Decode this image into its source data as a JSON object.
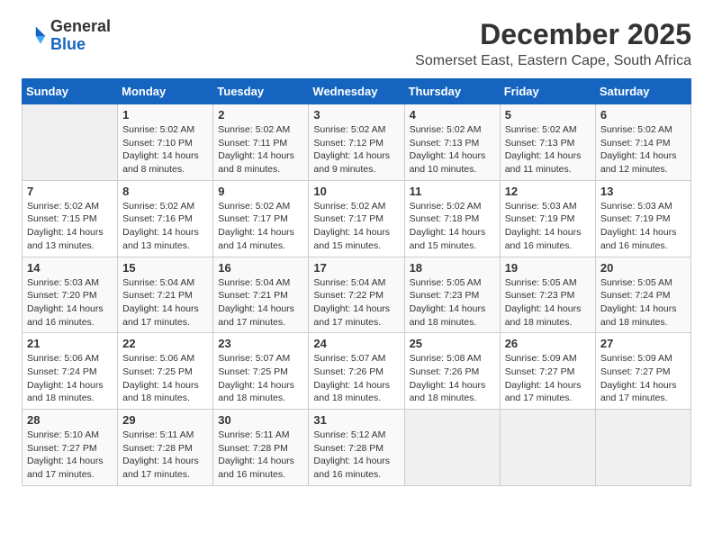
{
  "logo": {
    "general": "General",
    "blue": "Blue"
  },
  "header": {
    "month_year": "December 2025",
    "subtitle": "Somerset East, Eastern Cape, South Africa"
  },
  "days_of_week": [
    "Sunday",
    "Monday",
    "Tuesday",
    "Wednesday",
    "Thursday",
    "Friday",
    "Saturday"
  ],
  "weeks": [
    [
      {
        "day": "",
        "info": ""
      },
      {
        "day": "1",
        "info": "Sunrise: 5:02 AM\nSunset: 7:10 PM\nDaylight: 14 hours\nand 8 minutes."
      },
      {
        "day": "2",
        "info": "Sunrise: 5:02 AM\nSunset: 7:11 PM\nDaylight: 14 hours\nand 8 minutes."
      },
      {
        "day": "3",
        "info": "Sunrise: 5:02 AM\nSunset: 7:12 PM\nDaylight: 14 hours\nand 9 minutes."
      },
      {
        "day": "4",
        "info": "Sunrise: 5:02 AM\nSunset: 7:13 PM\nDaylight: 14 hours\nand 10 minutes."
      },
      {
        "day": "5",
        "info": "Sunrise: 5:02 AM\nSunset: 7:13 PM\nDaylight: 14 hours\nand 11 minutes."
      },
      {
        "day": "6",
        "info": "Sunrise: 5:02 AM\nSunset: 7:14 PM\nDaylight: 14 hours\nand 12 minutes."
      }
    ],
    [
      {
        "day": "7",
        "info": "Sunrise: 5:02 AM\nSunset: 7:15 PM\nDaylight: 14 hours\nand 13 minutes."
      },
      {
        "day": "8",
        "info": "Sunrise: 5:02 AM\nSunset: 7:16 PM\nDaylight: 14 hours\nand 13 minutes."
      },
      {
        "day": "9",
        "info": "Sunrise: 5:02 AM\nSunset: 7:17 PM\nDaylight: 14 hours\nand 14 minutes."
      },
      {
        "day": "10",
        "info": "Sunrise: 5:02 AM\nSunset: 7:17 PM\nDaylight: 14 hours\nand 15 minutes."
      },
      {
        "day": "11",
        "info": "Sunrise: 5:02 AM\nSunset: 7:18 PM\nDaylight: 14 hours\nand 15 minutes."
      },
      {
        "day": "12",
        "info": "Sunrise: 5:03 AM\nSunset: 7:19 PM\nDaylight: 14 hours\nand 16 minutes."
      },
      {
        "day": "13",
        "info": "Sunrise: 5:03 AM\nSunset: 7:19 PM\nDaylight: 14 hours\nand 16 minutes."
      }
    ],
    [
      {
        "day": "14",
        "info": "Sunrise: 5:03 AM\nSunset: 7:20 PM\nDaylight: 14 hours\nand 16 minutes."
      },
      {
        "day": "15",
        "info": "Sunrise: 5:04 AM\nSunset: 7:21 PM\nDaylight: 14 hours\nand 17 minutes."
      },
      {
        "day": "16",
        "info": "Sunrise: 5:04 AM\nSunset: 7:21 PM\nDaylight: 14 hours\nand 17 minutes."
      },
      {
        "day": "17",
        "info": "Sunrise: 5:04 AM\nSunset: 7:22 PM\nDaylight: 14 hours\nand 17 minutes."
      },
      {
        "day": "18",
        "info": "Sunrise: 5:05 AM\nSunset: 7:23 PM\nDaylight: 14 hours\nand 18 minutes."
      },
      {
        "day": "19",
        "info": "Sunrise: 5:05 AM\nSunset: 7:23 PM\nDaylight: 14 hours\nand 18 minutes."
      },
      {
        "day": "20",
        "info": "Sunrise: 5:05 AM\nSunset: 7:24 PM\nDaylight: 14 hours\nand 18 minutes."
      }
    ],
    [
      {
        "day": "21",
        "info": "Sunrise: 5:06 AM\nSunset: 7:24 PM\nDaylight: 14 hours\nand 18 minutes."
      },
      {
        "day": "22",
        "info": "Sunrise: 5:06 AM\nSunset: 7:25 PM\nDaylight: 14 hours\nand 18 minutes."
      },
      {
        "day": "23",
        "info": "Sunrise: 5:07 AM\nSunset: 7:25 PM\nDaylight: 14 hours\nand 18 minutes."
      },
      {
        "day": "24",
        "info": "Sunrise: 5:07 AM\nSunset: 7:26 PM\nDaylight: 14 hours\nand 18 minutes."
      },
      {
        "day": "25",
        "info": "Sunrise: 5:08 AM\nSunset: 7:26 PM\nDaylight: 14 hours\nand 18 minutes."
      },
      {
        "day": "26",
        "info": "Sunrise: 5:09 AM\nSunset: 7:27 PM\nDaylight: 14 hours\nand 17 minutes."
      },
      {
        "day": "27",
        "info": "Sunrise: 5:09 AM\nSunset: 7:27 PM\nDaylight: 14 hours\nand 17 minutes."
      }
    ],
    [
      {
        "day": "28",
        "info": "Sunrise: 5:10 AM\nSunset: 7:27 PM\nDaylight: 14 hours\nand 17 minutes."
      },
      {
        "day": "29",
        "info": "Sunrise: 5:11 AM\nSunset: 7:28 PM\nDaylight: 14 hours\nand 17 minutes."
      },
      {
        "day": "30",
        "info": "Sunrise: 5:11 AM\nSunset: 7:28 PM\nDaylight: 14 hours\nand 16 minutes."
      },
      {
        "day": "31",
        "info": "Sunrise: 5:12 AM\nSunset: 7:28 PM\nDaylight: 14 hours\nand 16 minutes."
      },
      {
        "day": "",
        "info": ""
      },
      {
        "day": "",
        "info": ""
      },
      {
        "day": "",
        "info": ""
      }
    ]
  ]
}
